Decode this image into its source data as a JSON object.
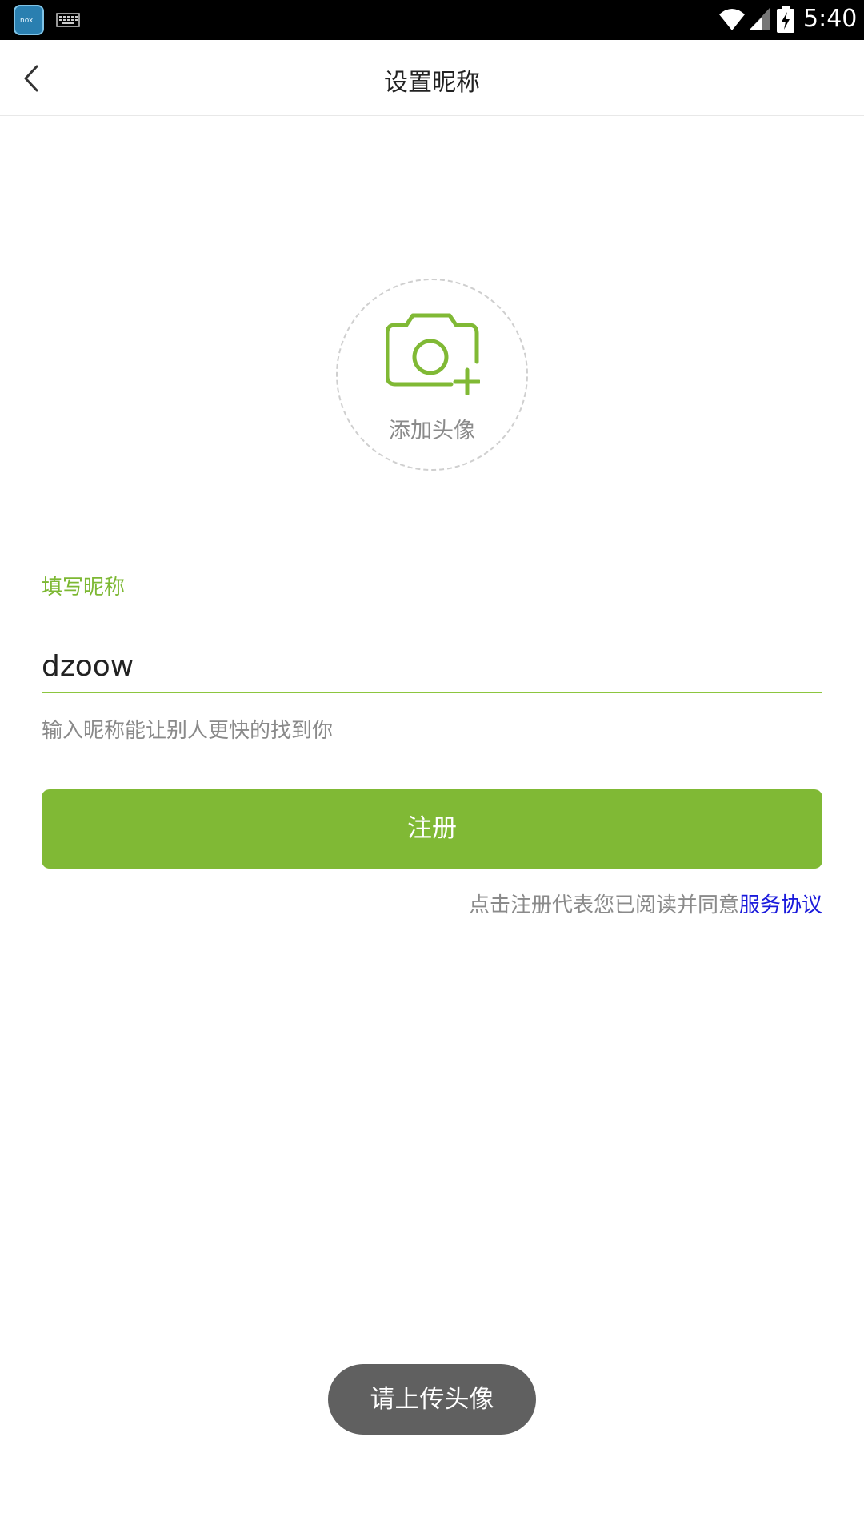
{
  "status_bar": {
    "app_icon_text": "nox",
    "time": "5:40",
    "icons": [
      "nox-app-icon",
      "keyboard-icon",
      "wifi-icon",
      "signal-icon",
      "battery-charging-icon"
    ]
  },
  "navbar": {
    "title": "设置昵称",
    "back_icon": "chevron-left-icon"
  },
  "avatar": {
    "icon": "camera-plus-icon",
    "label": "添加头像"
  },
  "nickname": {
    "label": "填写昵称",
    "value": "dzoow",
    "hint": "输入昵称能让别人更快的找到你"
  },
  "register_button": {
    "label": "注册"
  },
  "agreement": {
    "text": "点击注册代表您已阅读并同意",
    "link": "服务协议"
  },
  "toast": {
    "text": "请上传头像"
  },
  "colors": {
    "accent": "#80b935",
    "link": "#1a1adb",
    "toast_bg": "#606060"
  }
}
